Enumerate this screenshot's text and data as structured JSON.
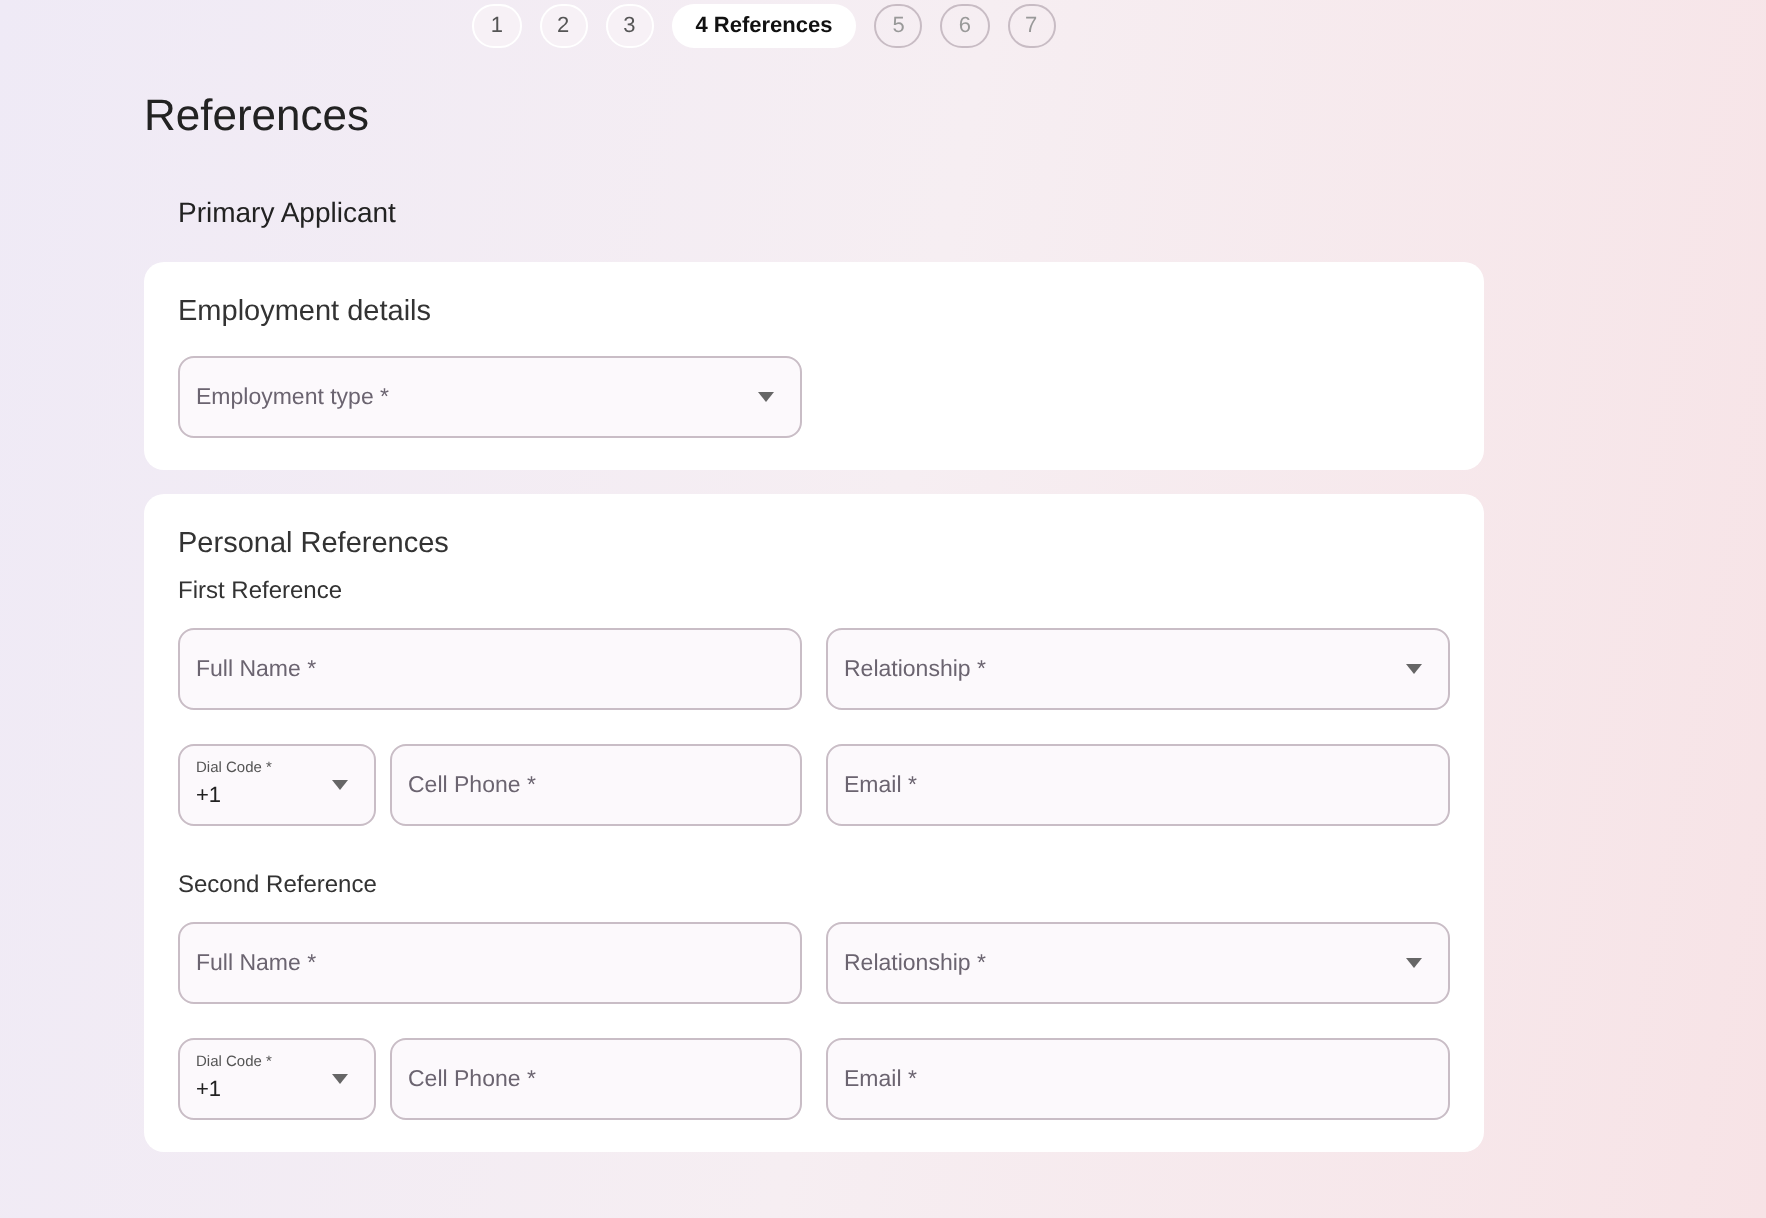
{
  "stepper": [
    {
      "label": "1",
      "completed": true,
      "selected": false
    },
    {
      "label": "2",
      "completed": true,
      "selected": false
    },
    {
      "label": "3",
      "completed": true,
      "selected": false
    },
    {
      "label": "4 References",
      "completed": false,
      "selected": true
    },
    {
      "label": "5",
      "completed": false,
      "selected": false
    },
    {
      "label": "6",
      "completed": false,
      "selected": false
    },
    {
      "label": "7",
      "completed": false,
      "selected": false
    }
  ],
  "title": "References",
  "applicant": "Primary Applicant",
  "employment": {
    "heading": "Employment details",
    "field": {
      "placeholder": "Employment type *"
    }
  },
  "personal": {
    "heading": "Personal References",
    "references": [
      {
        "heading": "First Reference",
        "full_name": {
          "placeholder": "Full Name *"
        },
        "relationship": {
          "placeholder": "Relationship *"
        },
        "dial_code": {
          "label": "Dial Code *",
          "value": "+1"
        },
        "cell_phone": {
          "placeholder": "Cell Phone *"
        },
        "email": {
          "placeholder": "Email *"
        }
      },
      {
        "heading": "Second Reference",
        "full_name": {
          "placeholder": "Full Name *"
        },
        "relationship": {
          "placeholder": "Relationship *"
        },
        "dial_code": {
          "label": "Dial Code *",
          "value": "+1"
        },
        "cell_phone": {
          "placeholder": "Cell Phone *"
        },
        "email": {
          "placeholder": "Email *"
        }
      }
    ]
  }
}
